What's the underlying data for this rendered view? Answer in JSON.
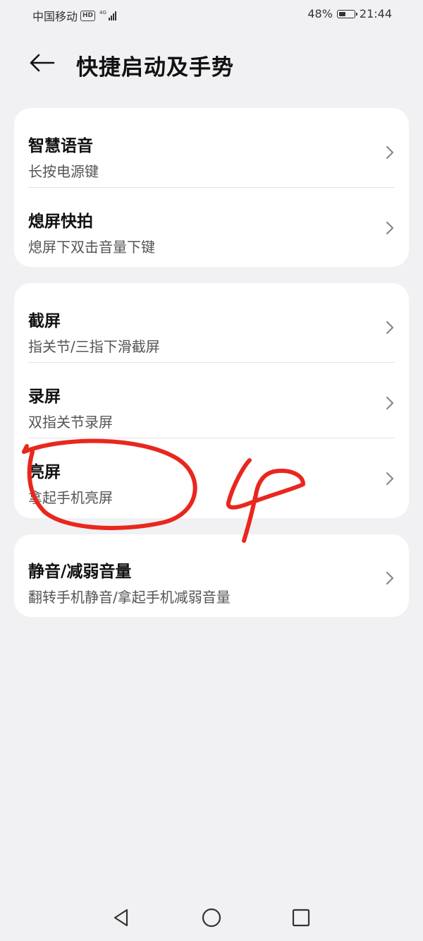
{
  "status_bar": {
    "carrier": "中国移动",
    "hd_badge": "HD",
    "network": "4G",
    "battery": "48%",
    "battery_level": 0.48,
    "time": "21:44"
  },
  "header": {
    "back_icon": "arrow-left-icon",
    "title": "快捷启动及手势"
  },
  "groups": [
    {
      "items": [
        {
          "title": "智慧语音",
          "subtitle": "长按电源键"
        },
        {
          "title": "熄屏快拍",
          "subtitle": "熄屏下双击音量下键"
        }
      ]
    },
    {
      "items": [
        {
          "title": "截屏",
          "subtitle": "指关节/三指下滑截屏"
        },
        {
          "title": "录屏",
          "subtitle": "双指关节录屏"
        },
        {
          "title": "亮屏",
          "subtitle": "拿起手机亮屏"
        }
      ]
    },
    {
      "items": [
        {
          "title": "静音/减弱音量",
          "subtitle": "翻转手机静音/拿起手机减弱音量"
        }
      ]
    }
  ],
  "annotation": {
    "color": "#e8271e",
    "shapes": "circle-and-number-4"
  },
  "nav_bar": {
    "back_icon": "triangle-back-icon",
    "home_icon": "circle-home-icon",
    "recents_icon": "square-recents-icon"
  },
  "colors": {
    "background": "#f1f1f3",
    "card": "#ffffff",
    "annotation_red": "#e8271e"
  }
}
